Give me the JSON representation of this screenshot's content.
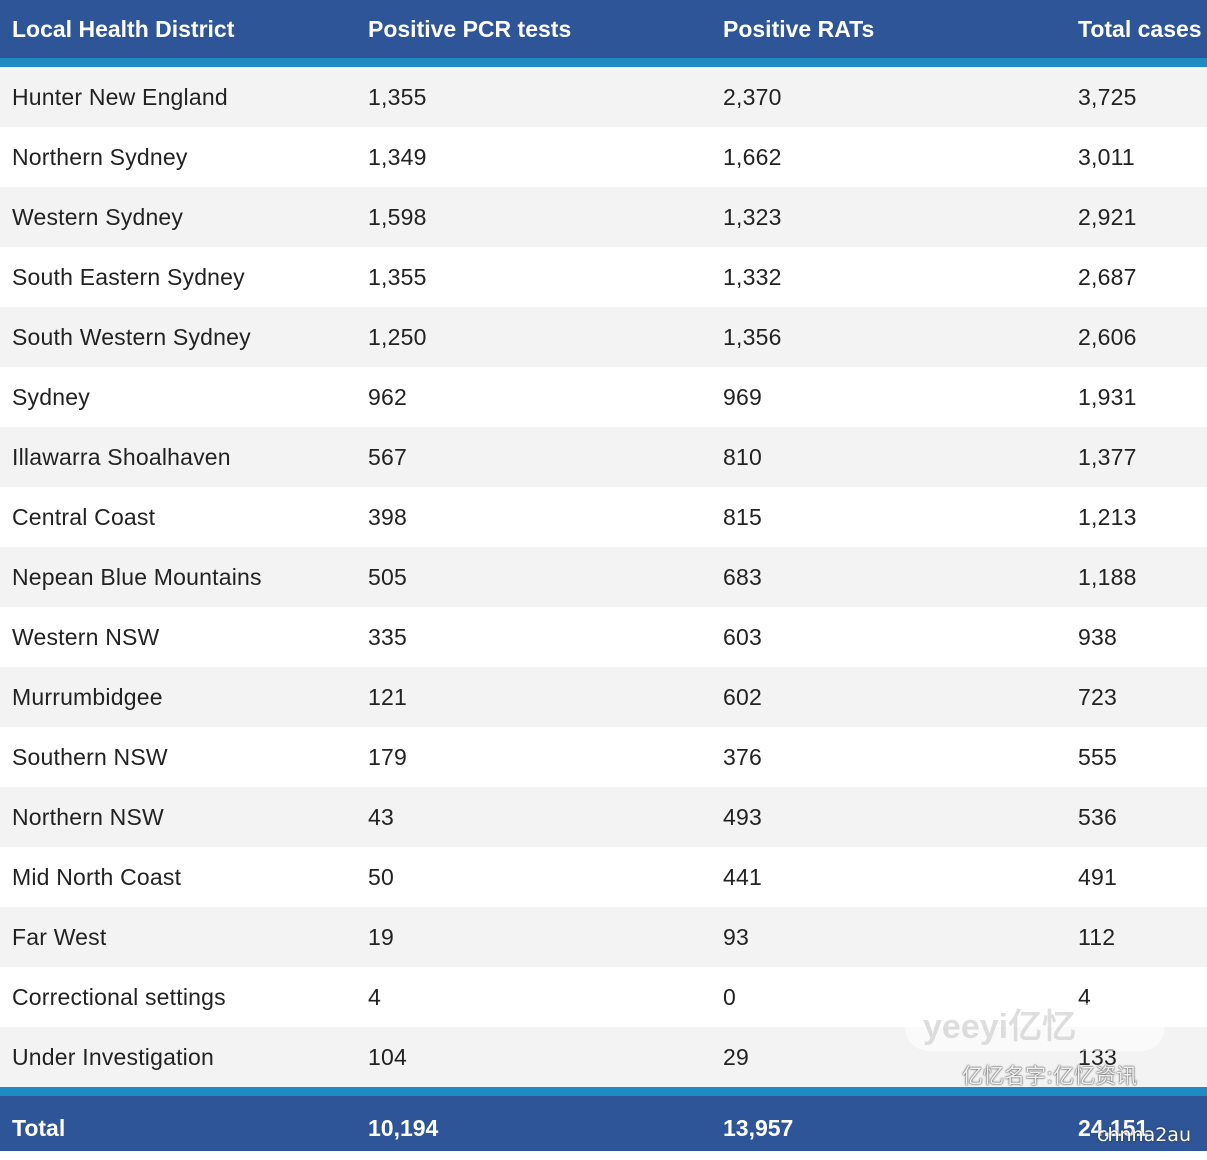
{
  "columns": [
    "Local Health District",
    "Positive PCR tests",
    "Positive RATs",
    "Total cases"
  ],
  "rows": [
    [
      "Hunter New England",
      "1,355",
      "2,370",
      "3,725"
    ],
    [
      "Northern Sydney",
      "1,349",
      "1,662",
      "3,011"
    ],
    [
      "Western Sydney",
      "1,598",
      "1,323",
      "2,921"
    ],
    [
      "South Eastern Sydney",
      "1,355",
      "1,332",
      "2,687"
    ],
    [
      "South Western Sydney",
      "1,250",
      "1,356",
      "2,606"
    ],
    [
      "Sydney",
      "962",
      "969",
      "1,931"
    ],
    [
      "Illawarra Shoalhaven",
      "567",
      "810",
      "1,377"
    ],
    [
      "Central Coast",
      "398",
      "815",
      "1,213"
    ],
    [
      "Nepean Blue Mountains",
      "505",
      "683",
      "1,188"
    ],
    [
      "Western NSW",
      "335",
      "603",
      "938"
    ],
    [
      "Murrumbidgee",
      "121",
      "602",
      "723"
    ],
    [
      "Southern NSW",
      "179",
      "376",
      "555"
    ],
    [
      "Northern NSW",
      "43",
      "493",
      "536"
    ],
    [
      "Mid North Coast",
      "50",
      "441",
      "491"
    ],
    [
      "Far West",
      "19",
      "93",
      "112"
    ],
    [
      "Correctional settings",
      "4",
      "0",
      "4"
    ],
    [
      "Under Investigation",
      "104",
      "29",
      "133"
    ]
  ],
  "total": [
    "Total",
    "10,194",
    "13,957",
    "24,151"
  ],
  "watermark": {
    "badge": "yeeyi亿忆",
    "line1": "亿忆名字:亿忆资讯",
    "line2": "chnna2au"
  },
  "colors": {
    "header_bg": "#2e5597",
    "accent": "#1e8bc3",
    "stripe": "#f3f3f3"
  }
}
